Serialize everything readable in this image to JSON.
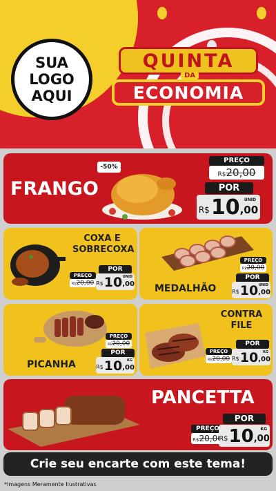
{
  "header": {
    "logo_lines": [
      "SUA",
      "LOGO",
      "AQUI"
    ],
    "title_top": "QUINTA",
    "title_mid": "DA",
    "title_bottom": "ECONOMIA"
  },
  "currency": "R$",
  "products": {
    "frango": {
      "name": "FRANGO",
      "badge": "-50%",
      "preco_label": "PREÇO",
      "old_price": "20,00",
      "por_label": "POR",
      "new_int": "10",
      "new_cents": ",00",
      "unit": "UNID",
      "image": "roast-chicken-icon"
    },
    "coxa": {
      "name_line1": "COXA E",
      "name_line2": "SOBRECOXA",
      "preco_label": "PREÇO",
      "old_price": "20,00",
      "por_label": "POR",
      "new_int": "10",
      "new_cents": ",00",
      "unit": "UNID",
      "image": "chicken-leg-pan-icon"
    },
    "medalhao": {
      "name": "MEDALHÃO",
      "preco_label": "PREÇO",
      "old_price": "20,00",
      "por_label": "POR",
      "new_int": "10",
      "new_cents": ",00",
      "unit": "UNID",
      "image": "medallion-skewers-icon"
    },
    "picanha": {
      "name": "PICANHA",
      "preco_label": "PREÇO",
      "old_price": "20,00",
      "por_label": "POR",
      "new_int": "10",
      "new_cents": ",00",
      "unit": "KG",
      "image": "sliced-steak-board-icon"
    },
    "contrafile": {
      "name_line1": "CONTRA",
      "name_line2": "FILE",
      "preco_label": "PREÇO",
      "old_price": "20,00",
      "por_label": "POR",
      "new_int": "10",
      "new_cents": ",00",
      "unit": "KG",
      "image": "grilled-steak-board-icon"
    },
    "pancetta": {
      "name": "PANCETTA",
      "preco_label": "PREÇO",
      "old_price": "20,00",
      "por_label": "POR",
      "new_int": "10",
      "new_cents": ",00",
      "unit": "KG",
      "image": "pork-belly-board-icon"
    }
  },
  "cta": "Crie seu encarte com este tema!",
  "footnote": "*Imagens Meramente Ilustrativas",
  "colors": {
    "red": "#c8161f",
    "yellow": "#f1c21d",
    "dark": "#1a1a1a"
  }
}
